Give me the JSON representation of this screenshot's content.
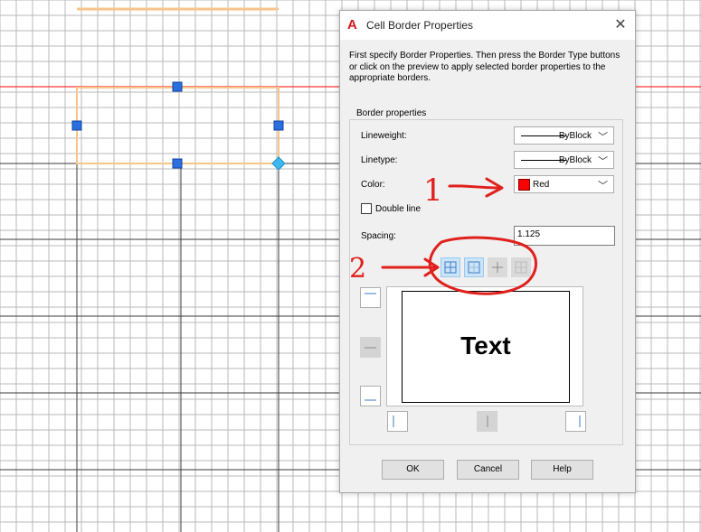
{
  "dialog": {
    "title": "Cell Border Properties",
    "app_icon_glyph": "A",
    "close_glyph": "✕",
    "instructions": "First specify Border Properties. Then press the Border Type buttons or click on the preview to apply selected border properties to the appropriate borders."
  },
  "border_properties": {
    "group_label": "Border properties",
    "lineweight": {
      "label": "Lineweight:",
      "value": "ByBlock"
    },
    "linetype": {
      "label": "Linetype:",
      "value": "ByBlock"
    },
    "color": {
      "label": "Color:",
      "value": "Red",
      "swatch": "#ff0000"
    },
    "double_line": {
      "label": "Double line",
      "checked": false
    },
    "spacing": {
      "label": "Spacing:",
      "value": "1.125"
    }
  },
  "preview": {
    "text": "Text"
  },
  "buttons": {
    "ok": "OK",
    "cancel": "Cancel",
    "help": "Help"
  },
  "annotations": {
    "arrow1_label": "1",
    "arrow2_label": "2",
    "ink_color": "#e0201c"
  },
  "colors": {
    "accent": "#0078d7",
    "selection_outline": "#f7c48a",
    "grip": "#2a6fe0",
    "red_line": "#ff0000"
  }
}
